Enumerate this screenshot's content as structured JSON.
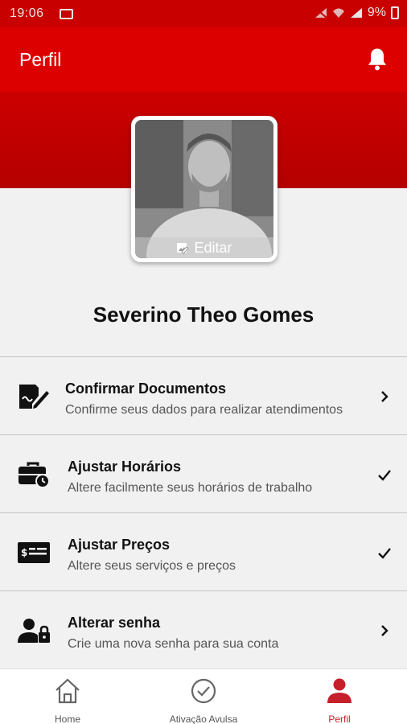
{
  "status_bar": {
    "time": "19:06",
    "battery": "9%"
  },
  "header": {
    "title": "Perfil"
  },
  "profile": {
    "edit_label": "Editar",
    "name": "Severino Theo Gomes"
  },
  "menu": [
    {
      "title": "Confirmar Documentos",
      "subtitle": "Confirme seus dados para realizar atendimentos",
      "icon": "document-edit-icon",
      "trailing": "chevron-right-icon"
    },
    {
      "title": "Ajustar Horários",
      "subtitle": "Altere facilmente seus horários de trabalho",
      "icon": "briefcase-clock-icon",
      "trailing": "checkmark-icon"
    },
    {
      "title": "Ajustar Preços",
      "subtitle": "Altere seus serviços e preços",
      "icon": "price-card-icon",
      "trailing": "checkmark-icon"
    },
    {
      "title": "Alterar senha",
      "subtitle": "Crie uma nova senha para sua conta",
      "icon": "user-lock-icon",
      "trailing": "chevron-right-icon"
    }
  ],
  "nav": [
    {
      "label": "Home",
      "icon": "home-icon"
    },
    {
      "label": "Ativação Avulsa",
      "icon": "check-circle-icon"
    },
    {
      "label": "Perfil",
      "icon": "person-icon",
      "active": true
    }
  ],
  "colors": {
    "header": "#dc0000",
    "status_bar": "#c90000",
    "active_nav": "#c61f2c"
  }
}
